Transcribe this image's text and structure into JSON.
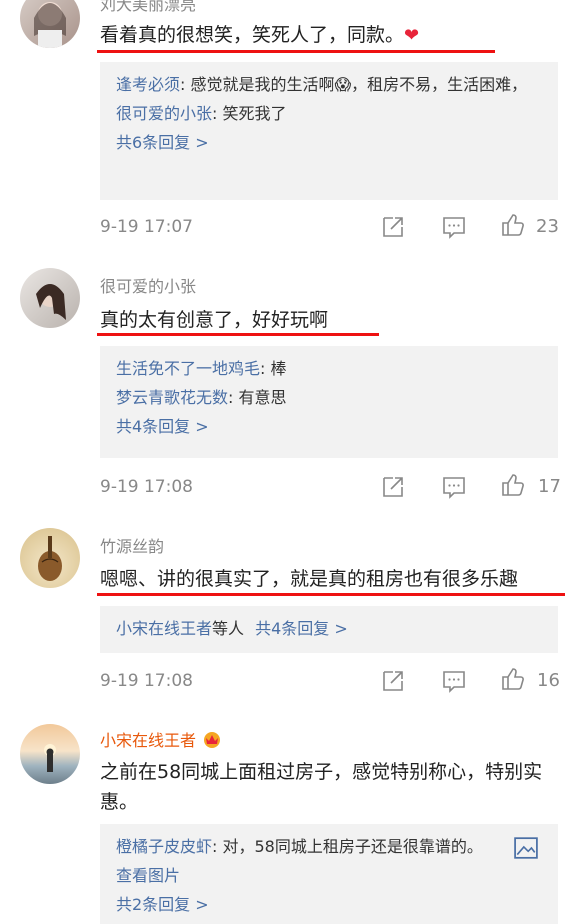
{
  "comments": [
    {
      "user": "刘大美丽漂亮",
      "text": "看着真的很想笑，笑死人了，同款。",
      "emoji": "❤",
      "replies": [
        {
          "user": "逢考必须",
          "text": ": 感觉就是我的生活啊😱，租房不易，生活困难，"
        },
        {
          "user": "很可爱的小张",
          "text": ": 笑死我了"
        }
      ],
      "more": "共6条回复 >",
      "time": "9-19 17:07",
      "likes": "23"
    },
    {
      "user": "很可爱的小张",
      "text": "真的太有创意了，好好玩啊",
      "replies": [
        {
          "user": "生活免不了一地鸡毛",
          "text": ": 棒"
        },
        {
          "user": "梦云青歌花无数",
          "text": ": 有意思"
        }
      ],
      "more": "共4条回复 >",
      "time": "9-19 17:08",
      "likes": "17"
    },
    {
      "user": "竹源丝韵",
      "text": "嗯嗯、讲的很真实了，就是真的租房也有很多乐趣",
      "reply_summary": {
        "user": "小宋在线王者",
        "suffix": "等人",
        "more": "共4条回复 >"
      },
      "time": "9-19 17:08",
      "likes": "16"
    },
    {
      "user": "小宋在线王者",
      "text": "之前在58同城上面租过房子，感觉特别称心，特别实惠。",
      "replies": [
        {
          "user": "橙橘子皮皮虾",
          "text": ": 对，58同城上租房子还是很靠谱的。"
        }
      ],
      "view_image": "查看图片",
      "more": "共2条回复 >"
    }
  ],
  "icons": {
    "share": "share-icon",
    "reply": "comment-icon",
    "like": "thumbs-up-icon",
    "image": "image-icon",
    "crown": "crown-badge-icon"
  },
  "colors": {
    "accent": "#e11111",
    "link": "#4a6fa5",
    "vip": "#e8590c"
  }
}
